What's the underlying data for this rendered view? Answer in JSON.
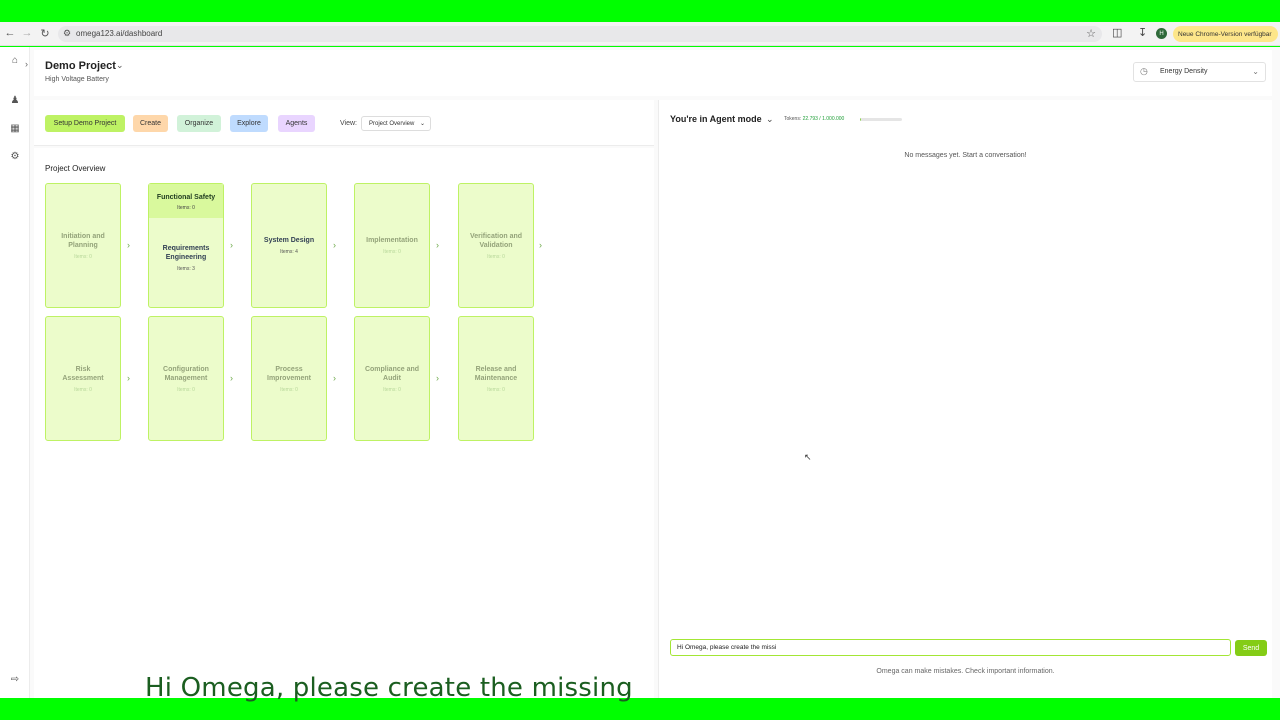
{
  "browser": {
    "url": "omega123.ai/dashboard",
    "profile_initial": "H",
    "update_label": "Neue Chrome-Version verfügbar"
  },
  "header": {
    "project_title": "Demo Project",
    "project_subtitle": "High Voltage Battery",
    "metric_select": "Energy Density"
  },
  "toolbar": {
    "buttons": [
      {
        "label": "Setup Demo Project",
        "color": "#bef264"
      },
      {
        "label": "Create",
        "color": "#fed7aa"
      },
      {
        "label": "Organize",
        "color": "#d1f2d9"
      },
      {
        "label": "Explore",
        "color": "#bfdbfe"
      },
      {
        "label": "Agents",
        "color": "#e9d5ff"
      }
    ],
    "view_label": "View:",
    "view_value": "Project Overview"
  },
  "overview": {
    "title": "Project Overview",
    "row1": [
      {
        "name_lines": [
          "Initiation and",
          "Planning"
        ],
        "items": "Items: 0"
      },
      {
        "top_name": "Functional Safety",
        "top_items": "Items: 0",
        "name_lines": [
          "Requirements",
          "Engineering"
        ],
        "items": "Items: 3"
      },
      {
        "name_lines": [
          "System Design"
        ],
        "items": "Items: 4"
      },
      {
        "name_lines": [
          "Implementation"
        ],
        "items": "Items: 0"
      },
      {
        "name_lines": [
          "Verification and",
          "Validation"
        ],
        "items": "Items: 0"
      }
    ],
    "row2": [
      {
        "name_lines": [
          "Risk",
          "Assessment"
        ],
        "items": "Items: 0"
      },
      {
        "name_lines": [
          "Configuration",
          "Management"
        ],
        "items": "Items: 0"
      },
      {
        "name_lines": [
          "Process",
          "Improvement"
        ],
        "items": "Items: 0"
      },
      {
        "name_lines": [
          "Compliance and",
          "Audit"
        ],
        "items": "Items: 0"
      },
      {
        "name_lines": [
          "Release and",
          "Maintenance"
        ],
        "items": "Items: 0"
      }
    ]
  },
  "caption": "Hi Omega, please create the missing",
  "agent": {
    "title": "You're in Agent mode",
    "tokens_label": "Tokens:",
    "tokens_value": "22.793 / 1.000.000",
    "token_fraction": 0.0228,
    "empty_message": "No messages yet. Start a conversation!",
    "input_value": "Hi Omega, please create the missi",
    "send_label": "Send",
    "disclaimer": "Omega can make mistakes. Check important information."
  }
}
